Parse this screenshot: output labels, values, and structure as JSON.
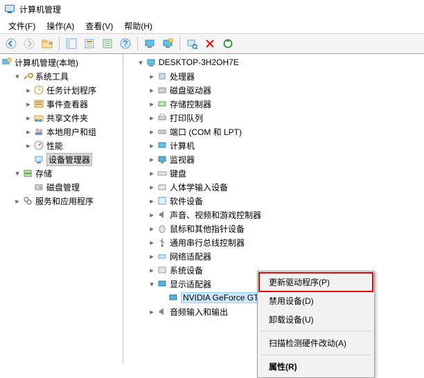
{
  "titlebar": {
    "title": "计算机管理"
  },
  "menubar": {
    "file": "文件(F)",
    "action": "操作(A)",
    "view": "查看(V)",
    "help": "帮助(H)"
  },
  "left_tree": {
    "root": "计算机管理(本地)",
    "system_tools": "系统工具",
    "task_scheduler": "任务计划程序",
    "event_viewer": "事件查看器",
    "shared_folders": "共享文件夹",
    "local_users": "本地用户和组",
    "performance": "性能",
    "device_manager": "设备管理器",
    "storage": "存储",
    "disk_mgmt": "磁盘管理",
    "services_apps": "服务和应用程序"
  },
  "right_tree": {
    "root": "DESKTOP-3H2OH7E",
    "processors": "处理器",
    "disk_drives": "磁盘驱动器",
    "storage_ctrl": "存储控制器",
    "print_queues": "打印队列",
    "ports": "端口 (COM 和 LPT)",
    "computer": "计算机",
    "monitors": "监视器",
    "keyboards": "键盘",
    "hid": "人体学输入设备",
    "software_dev": "软件设备",
    "sound": "声音、视频和游戏控制器",
    "mice": "鼠标和其他指针设备",
    "usb": "通用串行总线控制器",
    "network": "网络适配器",
    "system_devices": "系统设备",
    "display_adapters": "显示适配器",
    "gpu": "NVIDIA GeForce GT 7",
    "audio": "音频输入和输出"
  },
  "ctx": {
    "update": "更新驱动程序(P)",
    "disable": "禁用设备(D)",
    "uninstall": "卸载设备(U)",
    "scan": "扫描检测硬件改动(A)",
    "properties": "属性(R)"
  }
}
